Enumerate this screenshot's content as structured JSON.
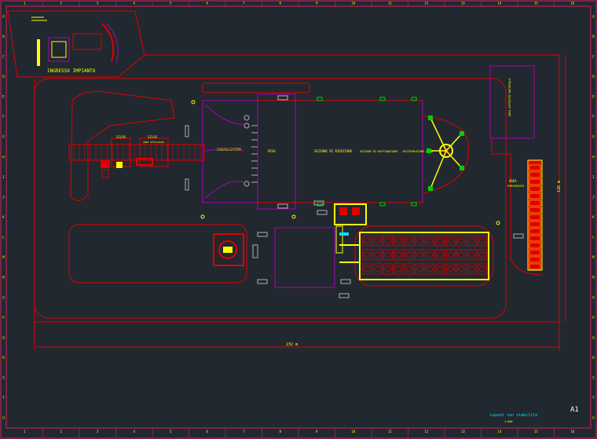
{
  "sheet": {
    "background": "#212830",
    "colors": {
      "frame": "#d81b60",
      "red": "#e00000",
      "magenta": "#b000b0",
      "yellow": "#ffff00",
      "cyan": "#00e5ff",
      "green": "#00d000",
      "gray": "#b0b0b0",
      "white": "#ffffff"
    },
    "col_numbers": [
      "1",
      "2",
      "3",
      "4",
      "5",
      "6",
      "7",
      "8",
      "9",
      "10",
      "11",
      "12",
      "13",
      "14",
      "15",
      "16"
    ],
    "row_letters": [
      "A",
      "B",
      "C",
      "D",
      "E",
      "F",
      "G",
      "H",
      "I",
      "J",
      "K",
      "L",
      "M",
      "N",
      "O",
      "P",
      "Q",
      "R",
      "S",
      "T",
      "U"
    ]
  },
  "labels": {
    "ingresso": "INGRESSO IMPIANTO",
    "dim_bottom": "232 m",
    "dim_right": "126 m",
    "title_block": "Layout con stabilito",
    "title_sub": "1:800",
    "sheet_size": "A1",
    "building_a": "PESA",
    "building_b": "SEZIONE DI RIDUZIONE",
    "building_c": "SEZIONE DI RAFFINAZIONE - DISTRIBUZIONE ARIA",
    "west_conveyor": "CONVOGLIATORE",
    "silo_left": "SILOS",
    "silo_right": "SILOS",
    "silo_note": "AREA STOCCAGGIO",
    "box_ne": "AREA DEPOSITO MATERIALE",
    "red_panel": "AREA",
    "red_panel_sub": "PARCHEGGIO"
  }
}
